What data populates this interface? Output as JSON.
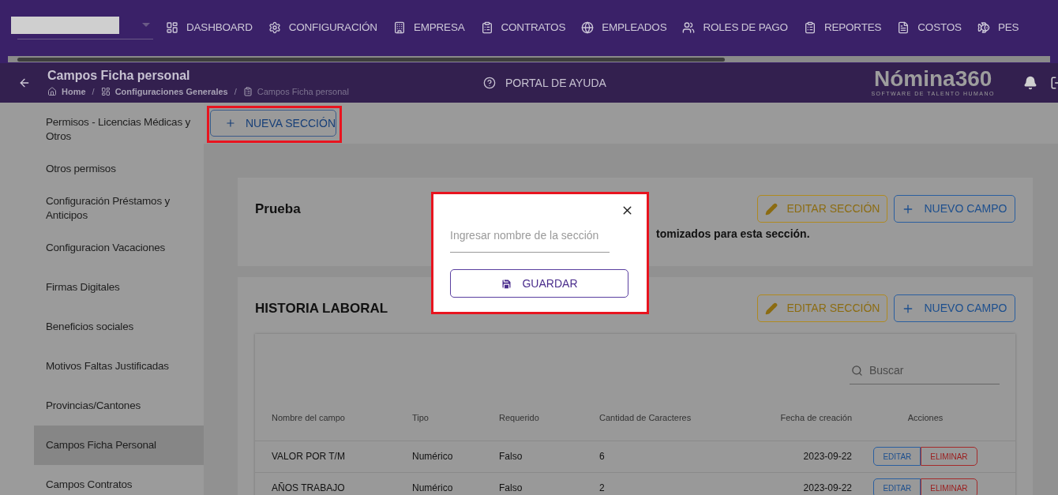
{
  "top_nav": {
    "items": [
      {
        "label": "DASHBOARD",
        "kind": "dashboard"
      },
      {
        "label": "CONFIGURACIÓN",
        "kind": "settings"
      },
      {
        "label": "EMPRESA",
        "kind": "building"
      },
      {
        "label": "CONTRATOS",
        "kind": "clipboard"
      },
      {
        "label": "EMPLEADOS",
        "kind": "globe"
      },
      {
        "label": "ROLES DE PAGO",
        "kind": "users"
      },
      {
        "label": "REPORTES",
        "kind": "clipboard"
      },
      {
        "label": "COSTOS",
        "kind": "file"
      },
      {
        "label": "PES",
        "kind": "fish"
      }
    ]
  },
  "header": {
    "title": "Campos Ficha personal",
    "breadcrumb": [
      {
        "label": "Home",
        "kind": "home"
      },
      {
        "label": "/",
        "kind": "separator"
      },
      {
        "label": "Configuraciones Generales",
        "kind": "dashboard"
      },
      {
        "label": "/",
        "kind": "separator"
      },
      {
        "label": "Campos Ficha personal",
        "kind": "clipboard"
      }
    ],
    "help": "PORTAL DE AYUDA",
    "logo": "Nómina360",
    "logo_tagline": "SOFTWARE DE TALENTO HUMANO"
  },
  "sidebar": {
    "items": [
      {
        "label": "Permisos - Licencias Médicas y Otros",
        "selected": false
      },
      {
        "label": "Otros permisos",
        "selected": false
      },
      {
        "label": "Configuración Préstamos y Anticipos",
        "selected": false
      },
      {
        "label": "Configuracion Vacaciones",
        "selected": false
      },
      {
        "label": "Firmas Digitales",
        "selected": false
      },
      {
        "label": "Beneficios sociales",
        "selected": false
      },
      {
        "label": "Motivos Faltas Justificadas",
        "selected": false
      },
      {
        "label": "Provincias/Cantones",
        "selected": false
      },
      {
        "label": "Campos Ficha Personal",
        "selected": true
      },
      {
        "label": "Campos Contratos",
        "selected": false
      }
    ]
  },
  "new_section_button": "NUEVA SECCIÓN",
  "sections": [
    {
      "title": "Prueba",
      "edit_button": "EDITAR SECCIÓN",
      "new_field_button": "NUEVO CAMPO",
      "message": "tomizados para esta sección."
    },
    {
      "title": "HISTORIA LABORAL",
      "edit_button": "EDITAR SECCIÓN",
      "new_field_button": "NUEVO CAMPO",
      "table": {
        "search_placeholder": "Buscar",
        "columns": [
          "Nombre del campo",
          "Tipo",
          "Requerido",
          "Cantidad de Caracteres",
          "Fecha de creación",
          "Acciones"
        ],
        "rows": [
          {
            "cells": [
              "VALOR POR T/M",
              "Numérico",
              "Falso",
              "6",
              "2023-09-22"
            ],
            "edit": "EDITAR",
            "delete": "ELIMINAR"
          },
          {
            "cells": [
              "AÑOS TRABAJO",
              "Numérico",
              "Falso",
              "2",
              "2023-09-22"
            ],
            "edit": "EDITAR",
            "delete": "ELIMINAR"
          }
        ]
      }
    }
  ],
  "dialog": {
    "placeholder": "Ingresar nombre de la sección",
    "save_button": "GUARDAR"
  }
}
